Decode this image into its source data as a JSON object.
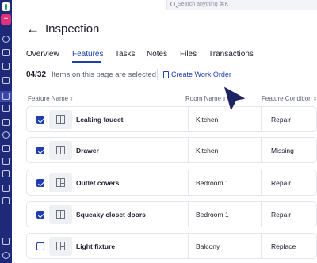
{
  "topbar": {
    "search_placeholder": "Search anything ⌘K"
  },
  "header": {
    "title": "Inspection"
  },
  "tabs": [
    {
      "label": "Overview"
    },
    {
      "label": "Features"
    },
    {
      "label": "Tasks"
    },
    {
      "label": "Notes"
    },
    {
      "label": "Files"
    },
    {
      "label": "Transactions"
    }
  ],
  "active_tab": "Features",
  "selection": {
    "count": "04/32",
    "text": "Items on this page are selected",
    "create_label": "Create Work Order"
  },
  "table": {
    "columns": [
      {
        "label": "Feature Name"
      },
      {
        "label": "Room Name"
      },
      {
        "label": "Feature Condition"
      }
    ],
    "rows": [
      {
        "feature": "Leaking faucet",
        "room": "Kitchen",
        "condition": "Repair",
        "checked": true
      },
      {
        "feature": "Drawer",
        "room": "Kitchen",
        "condition": "Missing",
        "checked": true
      },
      {
        "feature": "Outlet covers",
        "room": "Bedroom 1",
        "condition": "Repair",
        "checked": true
      },
      {
        "feature": "Squeaky closet doors",
        "room": "Bedroom 1",
        "condition": "Repair",
        "checked": true
      },
      {
        "feature": "Light fixture",
        "room": "Balcony",
        "condition": "Replace",
        "checked": false
      }
    ]
  },
  "colors": {
    "sidebar": "#1e2a78",
    "accent": "#1f3fb0",
    "add_button": "#e0327a"
  },
  "icons": {
    "sidebar": [
      "app-logo-icon",
      "plus-icon",
      "dashboard-icon",
      "sparkle-icon",
      "building-icon",
      "properties-icon",
      "inspection-icon",
      "people-icon",
      "calendar-icon",
      "info-icon",
      "reports-icon",
      "folder-icon",
      "document-icon",
      "chart-icon",
      "rocket-icon",
      "settings-icon"
    ],
    "search": "search-icon",
    "back": "back-arrow-icon",
    "create_work_order": "clipboard-icon",
    "row_thumbnail": "floorplan-icon",
    "sort": "sort-icon"
  }
}
